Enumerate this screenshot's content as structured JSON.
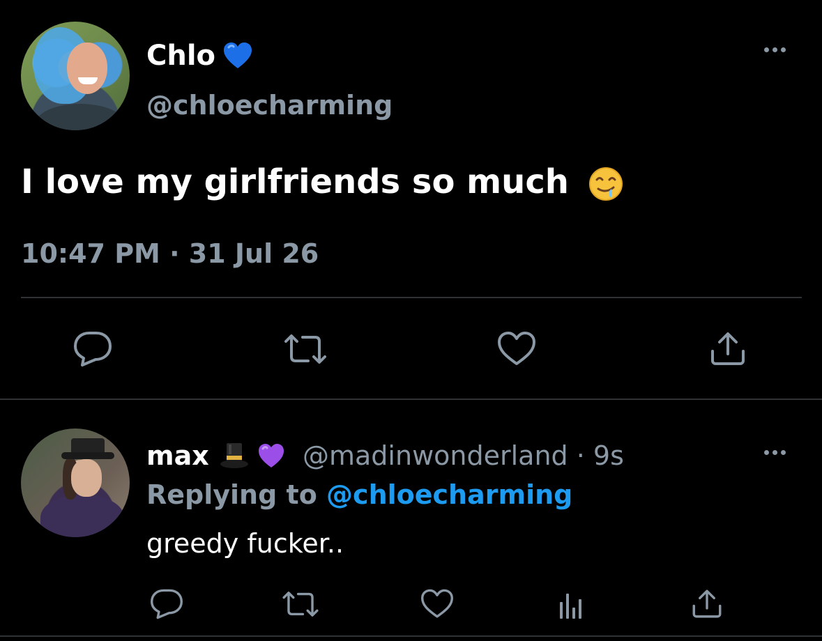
{
  "main_tweet": {
    "display_name": "Chlo",
    "badge_icon": "blue-heart-emoji",
    "badge_color": "#1d6fe8",
    "handle": "@chloecharming",
    "text": "I love my girlfriends so much",
    "text_emoji": "drooling-face-emoji",
    "time": "10:47 PM",
    "separator": " · ",
    "date": "31 Jul 26",
    "actions": [
      "reply-icon",
      "retweet-icon",
      "like-icon",
      "share-icon"
    ]
  },
  "reply_tweet": {
    "display_name": "max",
    "emoji_1": "top-hat-emoji",
    "emoji_2": "purple-heart-emoji",
    "handle": "@madinwonderland",
    "separator": " · ",
    "time_ago": "9s",
    "replying_prefix": "Replying to",
    "replying_to": "@chloecharming",
    "text": "greedy fucker..",
    "actions": [
      "reply-icon",
      "retweet-icon",
      "like-icon",
      "analytics-icon",
      "share-icon"
    ]
  },
  "colors": {
    "background": "#000000",
    "primary_text": "#ffffff",
    "secondary_text": "#8b98a5",
    "link": "#1d9bf0",
    "divider": "#2f3336"
  }
}
